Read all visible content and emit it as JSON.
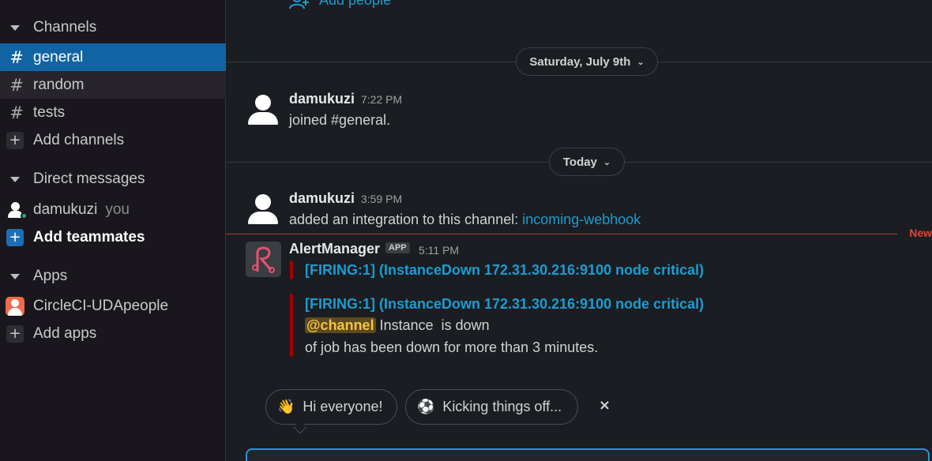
{
  "sidebar": {
    "channels_header": "Channels",
    "channels": [
      {
        "label": "general",
        "active": true
      },
      {
        "label": "random",
        "active": false
      },
      {
        "label": "tests",
        "active": false
      }
    ],
    "add_channels": "Add channels",
    "dm_header": "Direct messages",
    "dm_user": "damukuzi",
    "dm_you": "you",
    "add_teammates": "Add teammates",
    "apps_header": "Apps",
    "app_item": "CircleCI-UDApeople",
    "add_apps": "Add apps"
  },
  "main": {
    "add_people": "Add people",
    "date_divider_1": "Saturday, July 9th",
    "date_divider_2": "Today",
    "messages": [
      {
        "author": "damukuzi",
        "time": "7:22 PM",
        "text": "joined #general."
      },
      {
        "author": "damukuzi",
        "time": "3:59 PM",
        "text_prefix": "added an integration to this channel: ",
        "link": "incoming-webhook"
      }
    ],
    "new_marker": "New",
    "alert": {
      "author": "AlertManager",
      "badge": "APP",
      "time": "5:11 PM",
      "title_1": "[FIRING:1]  (InstanceDown 172.31.30.216:9100 node critical)",
      "title_2": "[FIRING:1]  (InstanceDown 172.31.30.216:9100 node critical)",
      "mention": "@channel",
      "line_1": " Instance  is down",
      "line_2": "of job  has been down for more than 3 minutes."
    },
    "chips": [
      {
        "emoji": "👋",
        "label": "Hi everyone!"
      },
      {
        "emoji": "⚽",
        "label": "Kicking things off..."
      }
    ],
    "chips_close": "×"
  },
  "colors": {
    "sidebar_bg": "#19171d",
    "active_item": "#1164a3",
    "link": "#1d9bd1",
    "new_marker": "#e0463a",
    "alert_bar": "#a30200"
  }
}
